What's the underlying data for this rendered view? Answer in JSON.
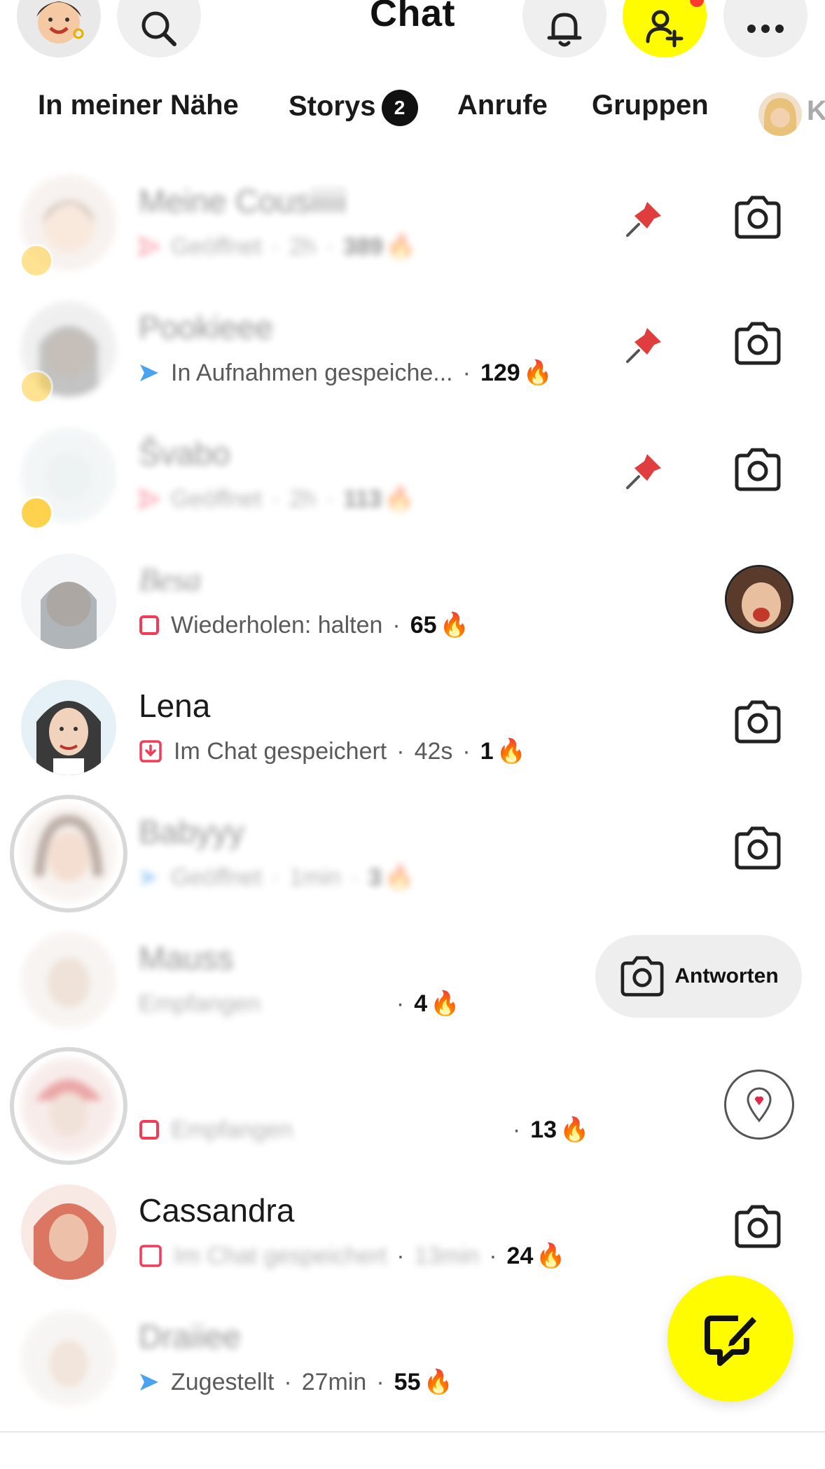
{
  "header": {
    "title": "Chat",
    "icons": [
      "bitmoji-avatar",
      "search-icon",
      "bell-icon",
      "add-friend-icon",
      "more-icon"
    ],
    "accent": "#fffc00"
  },
  "tabs": [
    {
      "label": "In meiner Nähe"
    },
    {
      "label": "Storys",
      "badge": "2"
    },
    {
      "label": "Anrufe"
    },
    {
      "label": "Gruppen"
    },
    {
      "label": "K"
    }
  ],
  "chats": [
    {
      "name": "Meine Cousiiiii",
      "status_icon": "sent-arrow-red",
      "status": "Geöffnet",
      "time": "2h",
      "streak": "389",
      "pinned": true,
      "action": "camera"
    },
    {
      "name": "Pookieee",
      "status_icon": "sent-arrow-blue",
      "status": "In Aufnahmen gespeiche...",
      "time": "",
      "streak": "129",
      "pinned": true,
      "action": "camera"
    },
    {
      "name": "Švabo",
      "status_icon": "sent-arrow-red",
      "status": "Geöffnet",
      "time": "2h",
      "streak": "113",
      "pinned": true,
      "action": "camera"
    },
    {
      "name": "Besa",
      "status_icon": "received-square-red",
      "status": "Wiederholen: halten",
      "time": "",
      "streak": "65",
      "pinned": false,
      "action": "story-bitmoji"
    },
    {
      "name": "Lena",
      "status_icon": "saved-chat-red",
      "status": "Im Chat gespeichert",
      "time": "42s",
      "streak": "1",
      "pinned": false,
      "action": "camera"
    },
    {
      "name": "Babyyy",
      "status_icon": "sent-arrow-blue",
      "status": "Geöffnet",
      "time": "1min",
      "streak": "3",
      "pinned": false,
      "action": "camera"
    },
    {
      "name": "Mauss",
      "status_icon": "received-square-red",
      "status": "Empfangen",
      "time": "",
      "streak": "4",
      "pinned": false,
      "action": "reply"
    },
    {
      "name": "",
      "status_icon": "received-square-red",
      "status": "Empfangen",
      "time": "",
      "streak": "13",
      "pinned": false,
      "action": "map"
    },
    {
      "name": "Cassandra",
      "status_icon": "saved-chat-red",
      "status": "Im Chat gespeichert",
      "time": "13min",
      "streak": "24",
      "pinned": false,
      "action": "camera"
    },
    {
      "name": "Draiiee",
      "status_icon": "sent-arrow-blue",
      "status": "Zugestellt",
      "time": "27min",
      "streak": "55",
      "pinned": false,
      "action": "camera"
    }
  ],
  "reply_button": {
    "label": "Antworten"
  },
  "fab": {
    "icon": "new-chat-icon"
  }
}
